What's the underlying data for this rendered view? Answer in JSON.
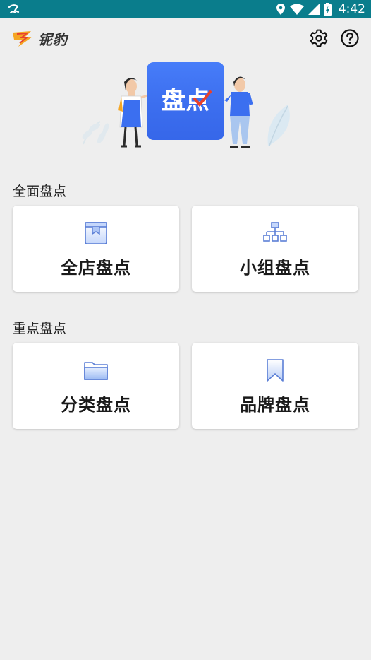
{
  "status_bar": {
    "time": "4:42"
  },
  "app": {
    "brand": "铌豹"
  },
  "sections": [
    {
      "title": "全面盘点",
      "cards": [
        {
          "label": "全店盘点",
          "icon": "box-icon"
        },
        {
          "label": "小组盘点",
          "icon": "org-chart-icon"
        }
      ]
    },
    {
      "title": "重点盘点",
      "cards": [
        {
          "label": "分类盘点",
          "icon": "folder-icon"
        },
        {
          "label": "品牌盘点",
          "icon": "bookmark-icon"
        }
      ]
    }
  ],
  "banner": {
    "sign_text": "盘点"
  },
  "colors": {
    "status_bar": "#0a7d8c",
    "accent_blue": "#3b6ff0",
    "background": "#eeeeee",
    "icon_blue": "#5b7fd6"
  }
}
